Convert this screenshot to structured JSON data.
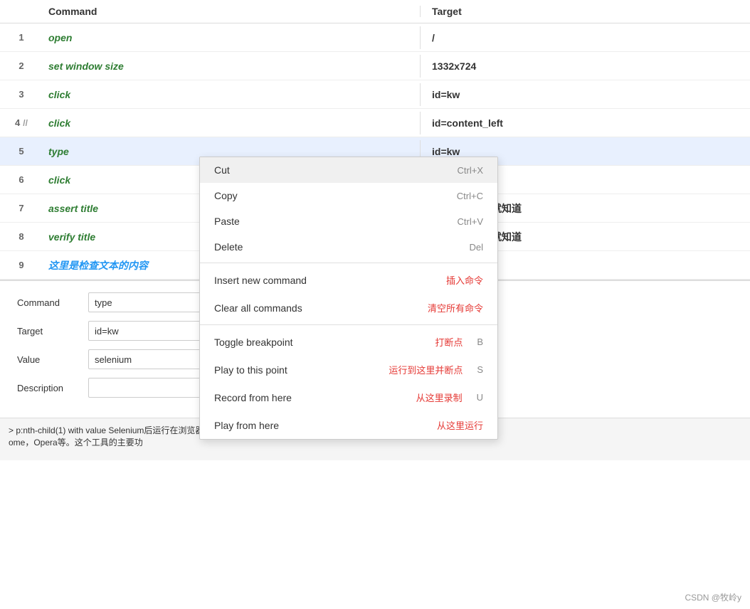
{
  "header": {
    "col_num": "",
    "col_command": "Command",
    "col_target": "Target"
  },
  "rows": [
    {
      "num": "1",
      "comment": "",
      "command": "open",
      "target": "/"
    },
    {
      "num": "2",
      "comment": "",
      "command": "set window size",
      "target": "1332x724"
    },
    {
      "num": "3",
      "comment": "",
      "command": "click",
      "target": "id=kw"
    },
    {
      "num": "4",
      "comment": "//",
      "command": "click",
      "target": "id=content_left"
    },
    {
      "num": "5",
      "comment": "",
      "command": "type",
      "target": "id=kw",
      "selected": true
    },
    {
      "num": "6",
      "comment": "",
      "command": "click",
      "target": ""
    },
    {
      "num": "7",
      "comment": "",
      "command": "assert title",
      "target": "百度一下，你就知道"
    },
    {
      "num": "8",
      "comment": "",
      "command": "verify title",
      "target": "百度一下，你就知道"
    },
    {
      "num": "9",
      "comment": "",
      "command": "这里是检查文本的内容",
      "target": "",
      "chinese_cmd": true
    }
  ],
  "context_menu": {
    "items": [
      {
        "label": "Cut",
        "chinese": "",
        "shortcut": "Ctrl+X",
        "divider_after": false
      },
      {
        "label": "Copy",
        "chinese": "",
        "shortcut": "Ctrl+C",
        "divider_after": false
      },
      {
        "label": "Paste",
        "chinese": "",
        "shortcut": "Ctrl+V",
        "divider_after": false
      },
      {
        "label": "Delete",
        "chinese": "",
        "shortcut": "Del",
        "divider_after": true
      },
      {
        "label": "Insert new command",
        "chinese": "插入命令",
        "shortcut": "",
        "divider_after": false
      },
      {
        "label": "Clear all commands",
        "chinese": "清空所有命令",
        "shortcut": "",
        "divider_after": true
      },
      {
        "label": "Toggle breakpoint",
        "chinese": "打断点",
        "shortcut": "B",
        "divider_after": false
      },
      {
        "label": "Play to this point",
        "chinese": "运行到这里并断点",
        "shortcut": "S",
        "divider_after": false
      },
      {
        "label": "Record from here",
        "chinese": "从这里录制",
        "shortcut": "U",
        "divider_after": false
      },
      {
        "label": "Play from here",
        "chinese": "从这里运行",
        "shortcut": "",
        "divider_after": false
      }
    ]
  },
  "form": {
    "command_label": "Command",
    "command_value": "type",
    "target_label": "Target",
    "target_value": "id=kw",
    "value_label": "Value",
    "value_value": "selenium",
    "description_label": "Description",
    "description_value": ""
  },
  "status": {
    "text": "> p:nth-child(1) with value Selenium后运行在浏览器中，就像真正的用户在操作\nome，Opera等。这个工具的主要功"
  },
  "watermark": "CSDN @牧岭y"
}
